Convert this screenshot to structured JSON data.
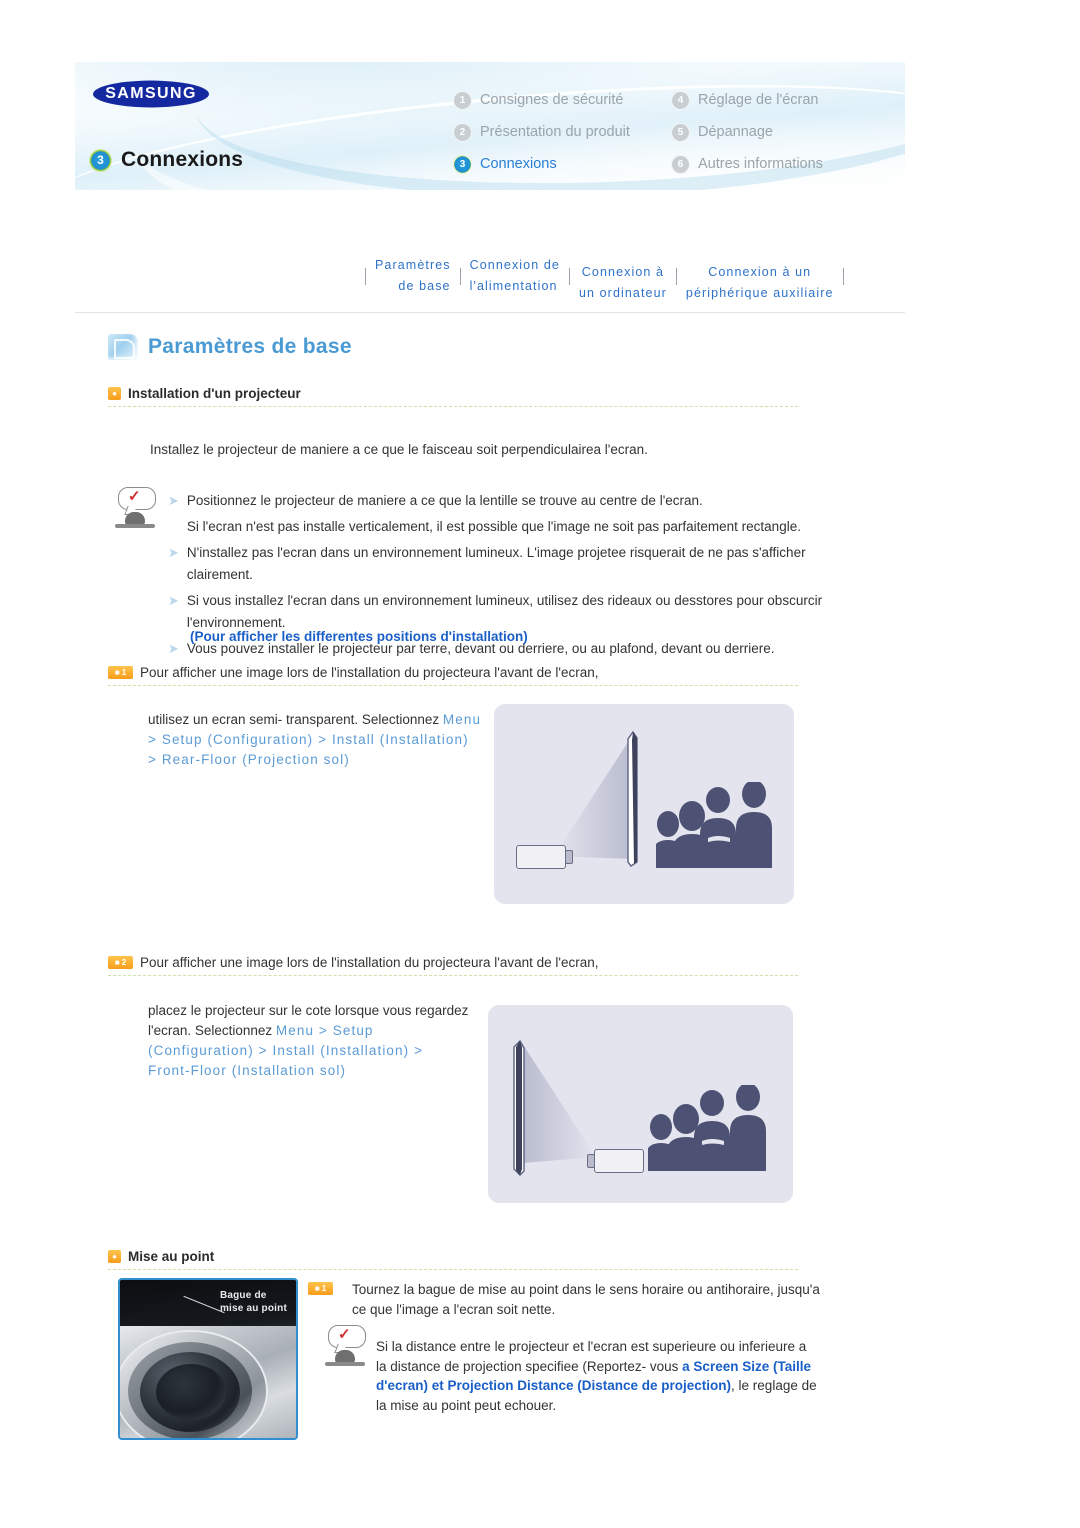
{
  "header": {
    "brand": "SAMSUNG",
    "chapter_number": "3",
    "chapter_title": "Connexions",
    "menu": [
      {
        "num": "1",
        "label": "Consignes de sécurité",
        "active": false
      },
      {
        "num": "4",
        "label": "Réglage de l'écran",
        "active": false
      },
      {
        "num": "2",
        "label": "Présentation du produit",
        "active": false
      },
      {
        "num": "5",
        "label": "Dépannage",
        "active": false
      },
      {
        "num": "3",
        "label": "Connexions",
        "active": true
      },
      {
        "num": "6",
        "label": "Autres informations",
        "active": false
      }
    ]
  },
  "tabs": [
    {
      "line1": "Paramètres",
      "line2": "de base"
    },
    {
      "line1": "Connexion de",
      "line2": "l'alimentation"
    },
    {
      "line1": "Connexion à",
      "line2": "un ordinateur"
    },
    {
      "line1": "Connexion à un",
      "line2": "périphérique auxiliaire"
    }
  ],
  "section": {
    "banner_title": "Paramètres de base",
    "heading1": "Installation d'un projecteur",
    "intro": "Installez le projecteur de maniere a ce que le faisceau soit perpendiculairea l'ecran."
  },
  "notes": [
    {
      "bullet": true,
      "text": "Positionnez le projecteur de maniere a ce que la lentille se trouve au centre de l'ecran."
    },
    {
      "bullet": false,
      "text": "Si l'ecran n'est pas installe verticalement, il est possible que l'image ne soit pas parfaitement rectangle."
    },
    {
      "bullet": true,
      "text": "N'installez pas l'ecran dans un environnement lumineux. L'image projetee risquerait de ne pas s'afficher clairement."
    },
    {
      "bullet": true,
      "text": "Si vous installez l'ecran dans un environnement lumineux, utilisez des rideaux ou desstores pour obscurcir l'environnement."
    },
    {
      "bullet": true,
      "text": "Vous pouvez installer le projecteur par terre, devant ou derriere, ou au plafond, devant ou derriere."
    }
  ],
  "note_link": "(Pour afficher les differentes positions d'installation)",
  "step1": {
    "badge": "1",
    "heading": "Pour afficher une image lors de l'installation du projecteura l'avant de l'ecran,",
    "body_prefix": "utilisez un ecran semi- transparent. Selectionnez ",
    "body_cmd_inline": "Menu",
    "cmd_line2": "> Setup (Configuration) > Install (Installation)",
    "cmd_line3": "> Rear-Floor (Projection sol)"
  },
  "step2": {
    "badge": "2",
    "heading": "Pour afficher une image lors de l'installation du projecteura l'avant de l'ecran,",
    "body_line1": "placez le projecteur sur le cote lorsque vous regardez",
    "body_line2_prefix": "l'ecran. Selectionnez ",
    "body_line2_cmd": "Menu > Setup",
    "cmd_line3": "(Configuration) > Install (Installation) >",
    "cmd_line4": "Front-Floor (Installation sol)"
  },
  "focus_section": {
    "heading": "Mise au point",
    "badge": "1",
    "step_line1": "Tournez la bague de mise au point dans le sens horaire ou antihoraire, jusqu'a",
    "step_line2": "ce que l'image a l'ecran soit nette.",
    "photo_callout_line1": "Bague de",
    "photo_callout_line2": "mise au point",
    "note_part1": "Si la distance entre le projecteur et l'ecran est superieure ou inferieure a la distance de projection specifiee (Reportez- vous ",
    "note_link": "a Screen Size (Taille d'ecran) et Projection Distance (Distance de projection)",
    "note_part2": ", le reglage de la mise au point peut echouer."
  },
  "colors": {
    "link_blue": "#1a5fc8",
    "command_blue": "#5b9bd5",
    "tab_blue": "#2f72c8",
    "section_title_blue": "#4b9ad4",
    "badge_orange": "#f79c1b",
    "samsung_blue": "#1428a0",
    "illustration_bg": "#e3e4ee",
    "silhouette": "#4d5274"
  }
}
